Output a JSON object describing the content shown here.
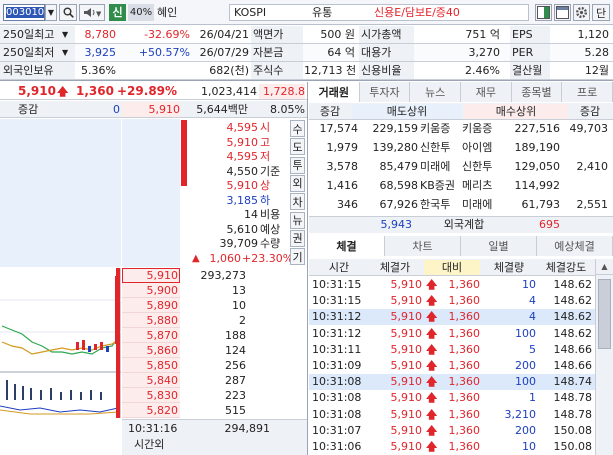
{
  "toolbar": {
    "code": "003010",
    "mode": "신",
    "zoom": "40%",
    "name": "혜인",
    "market": "KOSPI",
    "sector": "유통",
    "flags": "신용E/담보E/증40",
    "settings_label": "단"
  },
  "info_rows": [
    {
      "label": "250일최고",
      "value": "8,780",
      "pct": "-32.69%",
      "date": "26/04/21",
      "k1": "액면가",
      "v1": "500 원",
      "k2": "시가총액",
      "v2": "751 억",
      "k3": "EPS",
      "v3": "1,120"
    },
    {
      "label": "250일최저",
      "value": "3,925",
      "pct": "+50.57%",
      "date": "26/07/29",
      "k1": "자본금",
      "v1": "64 억",
      "k2": "대용가",
      "v2": "3,270",
      "k3": "PER",
      "v3": "5.28"
    },
    {
      "label": "외국인보유",
      "value": "5.36%",
      "pct": "",
      "date": "682(천)",
      "k1": "주식수",
      "v1": "12,713 천",
      "k2": "신용비율",
      "v2": "2.46%",
      "k3": "결산월",
      "v3": "12월"
    }
  ],
  "price": {
    "current": "5,910",
    "change": "1,360",
    "pct": "+29.89%",
    "volume": "1,023,414",
    "extra": "1,728.8"
  },
  "book_header": {
    "label": "증감",
    "zero": "0",
    "price": "5,910",
    "amount": "5,644백만",
    "ratio": "8.05%"
  },
  "summary": [
    {
      "v": "4,595",
      "k": "시",
      "c": "red"
    },
    {
      "v": "5,910",
      "k": "고",
      "c": "red"
    },
    {
      "v": "4,595",
      "k": "저",
      "c": "red"
    },
    {
      "v": "4,550",
      "k": "기준",
      "c": ""
    },
    {
      "v": "5,910",
      "k": "상",
      "c": "red"
    },
    {
      "v": "3,185",
      "k": "하",
      "c": "blue"
    },
    {
      "v": "14",
      "k": "비용",
      "c": ""
    },
    {
      "v": "5,610",
      "k": "예상",
      "c": ""
    },
    {
      "v": "39,709",
      "k": "수량",
      "c": ""
    },
    {
      "v": "1,060",
      "k": "+23.30%",
      "c": "red"
    }
  ],
  "side_buttons": [
    "수",
    "도",
    "투",
    "외",
    "차",
    "뉴",
    "권",
    "기"
  ],
  "bids": [
    {
      "p": "5,910",
      "q": "293,273"
    },
    {
      "p": "5,900",
      "q": "13"
    },
    {
      "p": "5,890",
      "q": "10"
    },
    {
      "p": "5,880",
      "q": "2"
    },
    {
      "p": "5,870",
      "q": "188"
    },
    {
      "p": "5,860",
      "q": "124"
    },
    {
      "p": "5,850",
      "q": "256"
    },
    {
      "p": "5,840",
      "q": "287"
    },
    {
      "p": "5,830",
      "q": "223"
    },
    {
      "p": "5,820",
      "q": "515"
    }
  ],
  "book_footer": {
    "time": "10:31:16",
    "total": "294,891",
    "label": "시간외"
  },
  "tabs_top": [
    "거래원",
    "투자자",
    "뉴스",
    "재무",
    "종목별",
    "프로"
  ],
  "broker_header": {
    "c1": "증감",
    "c2": "매도상위",
    "c3": "매수상위",
    "c4": "증감"
  },
  "brokers": [
    {
      "a": "17,574",
      "b": "229,159",
      "n1": "키움증",
      "n2": "키움증",
      "c": "227,516",
      "d": "49,703"
    },
    {
      "a": "1,979",
      "b": "139,280",
      "n1": "신한투",
      "n2": "아이엠",
      "c": "189,190",
      "d": ""
    },
    {
      "a": "3,578",
      "b": "85,479",
      "n1": "미래에",
      "n2": "신한투",
      "c": "129,050",
      "d": "2,410"
    },
    {
      "a": "1,416",
      "b": "68,598",
      "n1": "KB증권",
      "n2": "메리츠",
      "c": "114,992",
      "d": ""
    },
    {
      "a": "346",
      "b": "67,926",
      "n1": "한국투",
      "n2": "미래에",
      "c": "61,793",
      "d": "2,551"
    }
  ],
  "foreign": {
    "sell": "5,943",
    "label": "외국계합",
    "buy": "695"
  },
  "tabs_bottom": [
    "체결",
    "차트",
    "일별",
    "예상체결"
  ],
  "trade_header": {
    "time": "시간",
    "price": "체결가",
    "change": "대비",
    "qty": "체결량",
    "strength": "체결강도"
  },
  "trades": [
    {
      "t": "10:31:15",
      "p": "5,910",
      "d": "1,360",
      "q": "10",
      "s": "148.62",
      "hl": false
    },
    {
      "t": "10:31:15",
      "p": "5,910",
      "d": "1,360",
      "q": "4",
      "s": "148.62",
      "hl": false
    },
    {
      "t": "10:31:12",
      "p": "5,910",
      "d": "1,360",
      "q": "4",
      "s": "148.62",
      "hl": true
    },
    {
      "t": "10:31:12",
      "p": "5,910",
      "d": "1,360",
      "q": "100",
      "s": "148.62",
      "hl": false
    },
    {
      "t": "10:31:11",
      "p": "5,910",
      "d": "1,360",
      "q": "5",
      "s": "148.66",
      "hl": false
    },
    {
      "t": "10:31:09",
      "p": "5,910",
      "d": "1,360",
      "q": "200",
      "s": "148.66",
      "hl": false
    },
    {
      "t": "10:31:08",
      "p": "5,910",
      "d": "1,360",
      "q": "100",
      "s": "148.74",
      "hl": true
    },
    {
      "t": "10:31:08",
      "p": "5,910",
      "d": "1,360",
      "q": "1",
      "s": "148.78",
      "hl": false
    },
    {
      "t": "10:31:08",
      "p": "5,910",
      "d": "1,360",
      "q": "3,210",
      "s": "148.78",
      "hl": false
    },
    {
      "t": "10:31:07",
      "p": "5,910",
      "d": "1,360",
      "q": "200",
      "s": "150.08",
      "hl": false
    },
    {
      "t": "10:31:06",
      "p": "5,910",
      "d": "1,360",
      "q": "10",
      "s": "150.08",
      "hl": false
    }
  ],
  "colors": {
    "up": "#e0252b",
    "down": "#1c3fbf",
    "header_bg": "#eef1f6",
    "highlight": "#dbe9fb",
    "ask_bg": "#e8f0fb",
    "bid_bg": "#fdecec"
  }
}
